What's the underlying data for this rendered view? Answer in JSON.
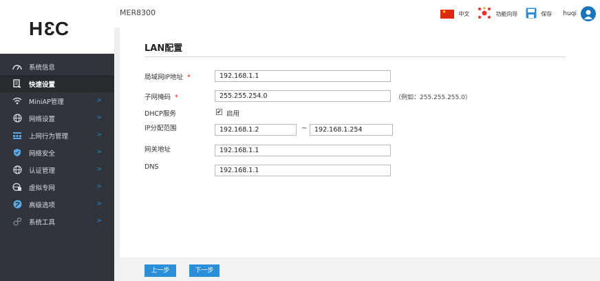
{
  "header": {
    "device_name": "MER8300",
    "language": "中文",
    "wizard": "功能向导",
    "save": "保存",
    "user": "huqi"
  },
  "logo": {
    "left": "H",
    "middle": "3",
    "right": "C"
  },
  "sidebar": {
    "items": [
      {
        "label": "系统信息",
        "icon": "speedometer-icon"
      },
      {
        "label": "快速设置",
        "icon": "quick-setup-icon",
        "active": true
      },
      {
        "label": "MiniAP管理",
        "icon": "wifi-icon",
        "arrow": ">"
      },
      {
        "label": "网络设置",
        "icon": "globe-icon",
        "arrow": ">"
      },
      {
        "label": "上网行为管理",
        "icon": "behavior-icon",
        "arrow": ">"
      },
      {
        "label": "网络安全",
        "icon": "shield-icon",
        "arrow": ">"
      },
      {
        "label": "认证管理",
        "icon": "auth-globe-icon",
        "arrow": ">"
      },
      {
        "label": "虚拟专网",
        "icon": "vpn-icon",
        "arrow": ">"
      },
      {
        "label": "高级选项",
        "icon": "advanced-icon",
        "arrow": ">"
      },
      {
        "label": "系统工具",
        "icon": "tools-icon",
        "arrow": ">"
      }
    ]
  },
  "main": {
    "title": "LAN配置",
    "required_mark": "*",
    "lan_ip_label": "局域网IP地址",
    "lan_ip_value": "192.168.1.1",
    "mask_label": "子网掩码",
    "mask_value": "255.255.254.0",
    "mask_hint": "（例如：255.255.255.0）",
    "dhcp_label": "DHCP服务",
    "dhcp_checkbox_mark": "✔",
    "dhcp_enable_label": "启用",
    "ip_range_label": "IP分配范围",
    "ip_range_start": "192.168.1.2",
    "ip_range_sep": "~",
    "ip_range_end": "192.168.1.254",
    "gateway_label": "网关地址",
    "gateway_value": "192.168.1.1",
    "dns_label": "DNS",
    "dns_value": "192.168.1.1"
  },
  "footer": {
    "prev_label": "上一步",
    "next_label": "下一步"
  },
  "colors": {
    "sidebar_bg": "#2f353b",
    "accent": "#2a8fd6",
    "required": "#e02020"
  }
}
